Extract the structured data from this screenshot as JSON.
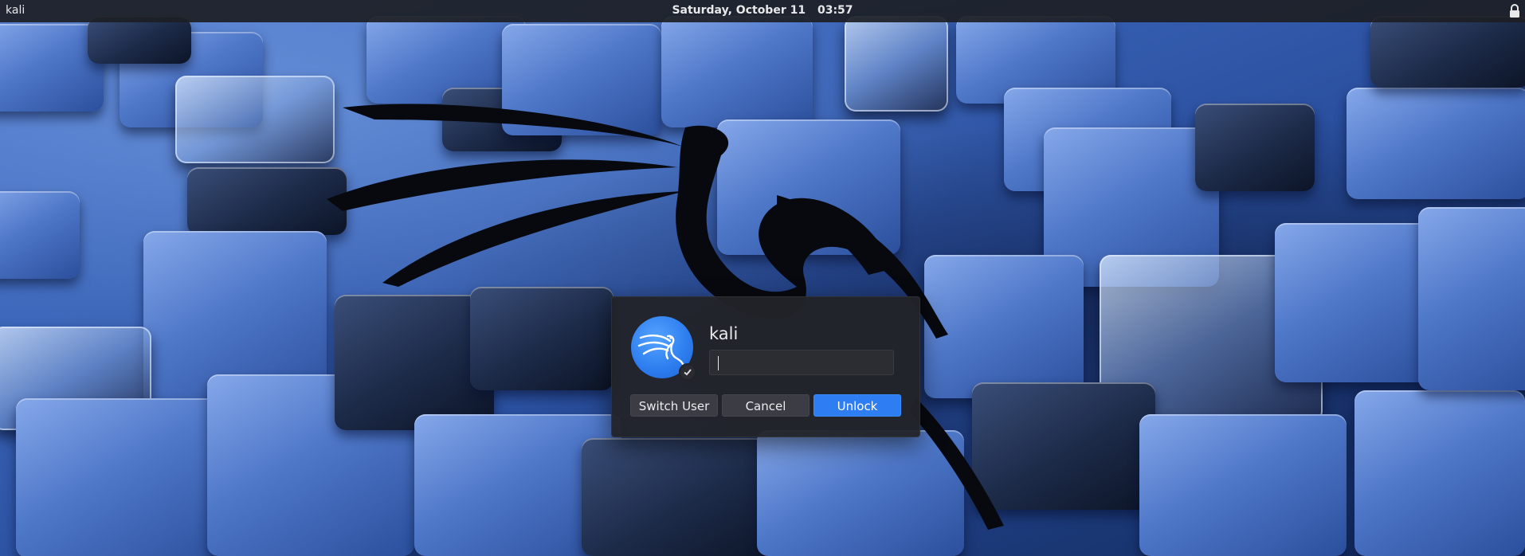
{
  "topbar": {
    "hostname": "kali",
    "date": "Saturday, October 11",
    "time": "03:57",
    "lock_icon": "lock-icon"
  },
  "dialog": {
    "username": "kali",
    "password_value": "",
    "avatar_icon": "kali-dragon-icon",
    "badge_icon": "check-icon",
    "buttons": {
      "switch_user": "Switch User",
      "cancel": "Cancel",
      "unlock": "Unlock"
    }
  },
  "colors": {
    "accent": "#2f7df2",
    "topbar_bg": "#1c1e24",
    "dialog_bg": "#222329"
  }
}
